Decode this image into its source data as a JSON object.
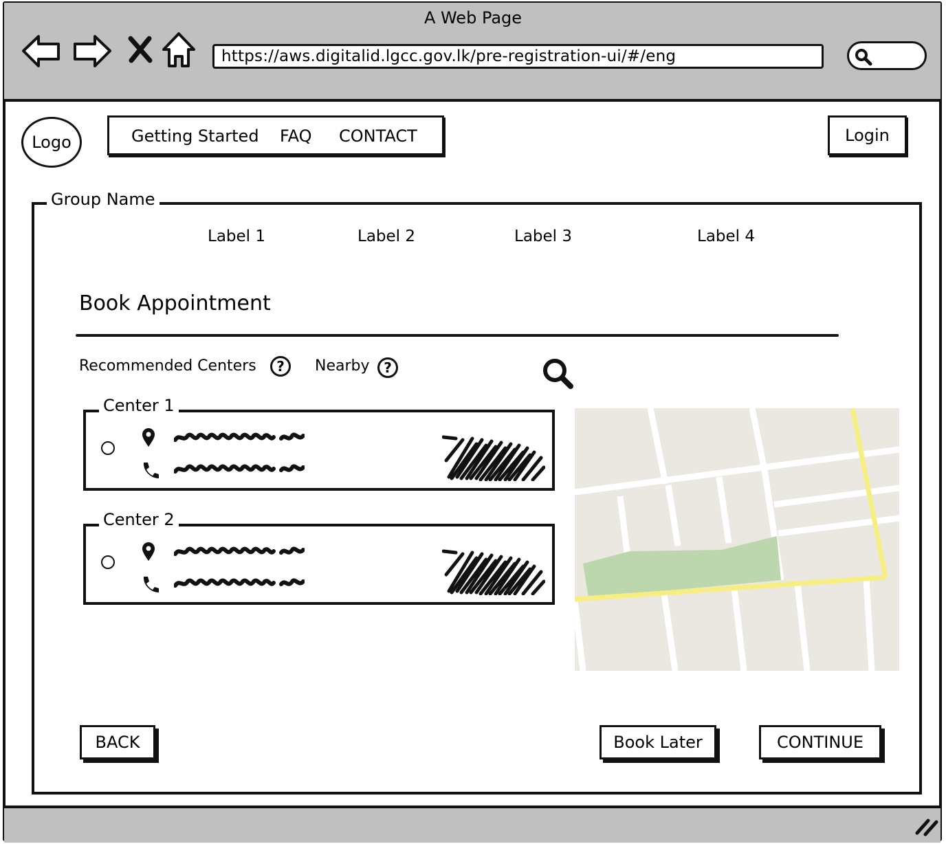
{
  "browser": {
    "window_title": "A Web Page",
    "url": "https://aws.digitalid.lgcc.gov.lk/pre-registration-ui/#/eng",
    "nav_icons": [
      "back-arrow-icon",
      "forward-arrow-icon",
      "close-icon",
      "home-icon",
      "search-icon",
      "resize-grip-icon"
    ]
  },
  "header": {
    "logo_label": "Logo",
    "nav_items": [
      "Getting Started",
      "FAQ",
      "CONTACT"
    ],
    "login_label": "Login"
  },
  "group": {
    "title": "Group Name",
    "labels": [
      "Label 1",
      "Label 2",
      "Label 3",
      "Label 4"
    ]
  },
  "section": {
    "title": "Book Appointment",
    "tabs": [
      "Recommended Centers",
      "Nearby"
    ],
    "help_glyph": "?"
  },
  "centers": [
    {
      "title": "Center 1",
      "selected": false,
      "icons": [
        "location-pin-icon",
        "phone-icon"
      ]
    },
    {
      "title": "Center 2",
      "selected": false,
      "icons": [
        "location-pin-icon",
        "phone-icon"
      ]
    }
  ],
  "map": {
    "colors": {
      "block": "#ebe8e2",
      "road": "#ffffff",
      "highway": "#f7ee82",
      "park": "#bcd6ad"
    }
  },
  "actions": {
    "back_label": "BACK",
    "book_later_label": "Book Later",
    "continue_label": "CONTINUE"
  }
}
